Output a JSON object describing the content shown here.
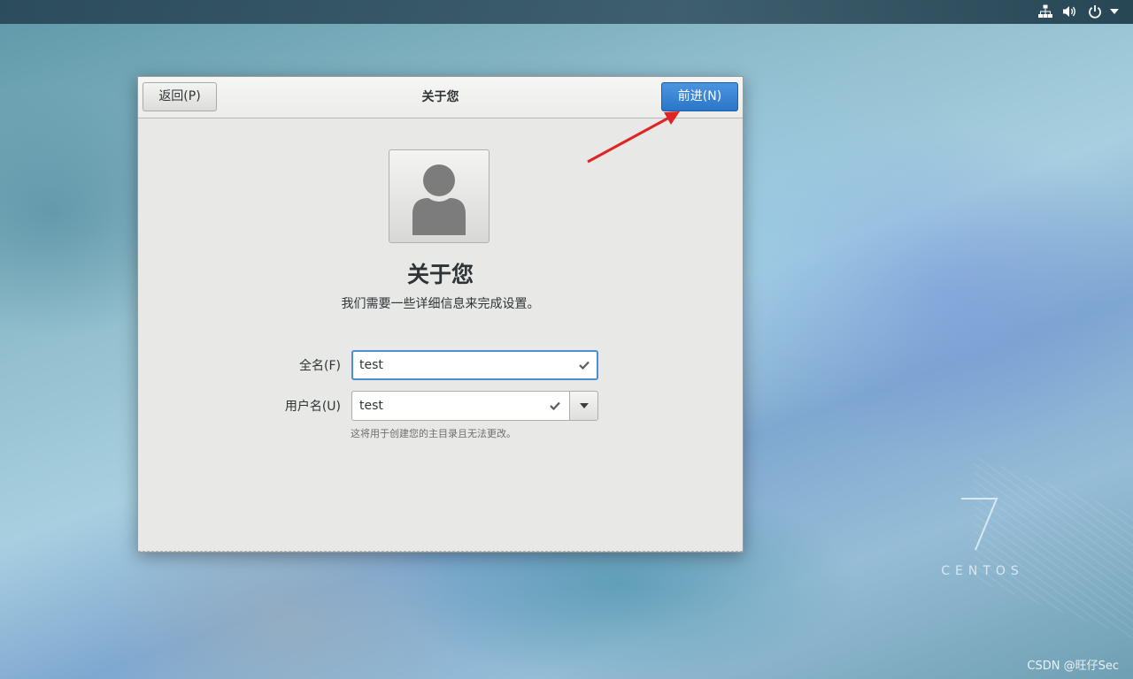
{
  "tray": {
    "icons": [
      "network-icon",
      "volume-icon",
      "power-icon",
      "chevron-down-icon"
    ]
  },
  "dialog": {
    "title": "关于您",
    "back_label": "返回(P)",
    "next_label": "前进(N)",
    "heading": "关于您",
    "subtitle": "我们需要一些详细信息来完成设置。",
    "avatar_icon": "user-avatar-icon"
  },
  "form": {
    "fullname": {
      "label": "全名(F)",
      "value": "test"
    },
    "username": {
      "label": "用户名(U)",
      "value": "test",
      "hint": "这将用于创建您的主目录且无法更改。"
    }
  },
  "branding": {
    "centos_numeral": "7",
    "centos_word": "CENTOS"
  },
  "watermark": "CSDN @旺仔Sec",
  "colors": {
    "accent": "#2b76c8",
    "annotation_arrow": "#e02424"
  }
}
